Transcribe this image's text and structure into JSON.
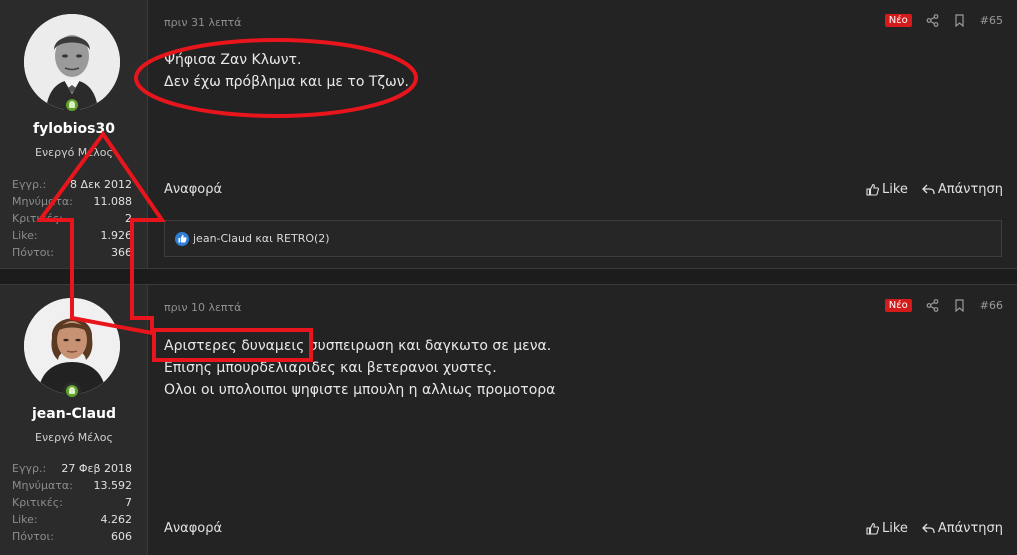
{
  "posts": [
    {
      "username": "fylobios30",
      "user_title": "Ενεργό Μέλος",
      "stats": [
        {
          "label": "Εγγρ.:",
          "value": "8 Δεκ 2012"
        },
        {
          "label": "Μηνύματα:",
          "value": "11.088"
        },
        {
          "label": "Κριτικές:",
          "value": "2"
        },
        {
          "label": "Like:",
          "value": "1.926"
        },
        {
          "label": "Πόντοι:",
          "value": "366"
        }
      ],
      "time": "πριν 31 λεπτά",
      "badge": "Νέο",
      "number": "#65",
      "body": [
        "Ψήφισα Ζαν Κλωντ.",
        "Δεν έχω πρόβλημα και με το Τζων."
      ],
      "report": "Αναφορά",
      "like": "Like",
      "reply": "Απάντηση",
      "reactions": "jean-Claud και RETRO(2)"
    },
    {
      "username": "jean-Claud",
      "user_title": "Ενεργό Μέλος",
      "stats": [
        {
          "label": "Εγγρ.:",
          "value": "27 Φεβ 2018"
        },
        {
          "label": "Μηνύματα:",
          "value": "13.592"
        },
        {
          "label": "Κριτικές:",
          "value": "7"
        },
        {
          "label": "Like:",
          "value": "4.262"
        },
        {
          "label": "Πόντοι:",
          "value": "606"
        }
      ],
      "time": "πριν 10 λεπτά",
      "badge": "Νέο",
      "number": "#66",
      "body": [
        "Αριστερες δυναμεις συσπειρωση και δαγκωτο σε μενα.",
        "Επισης μπουρδελιαριδες και βετερανοι χυστες.",
        "Ολοι οι υπολοιποι ψηφιστε μπουλη η αλλιως προμοτορα"
      ],
      "report": "Αναφορά",
      "like": "Like",
      "reply": "Απάντηση"
    }
  ],
  "annotation_color": "#e8151c",
  "accent_blue": "#2f7fd6",
  "badge_red": "#d41b1b",
  "online_green": "#63a12d"
}
